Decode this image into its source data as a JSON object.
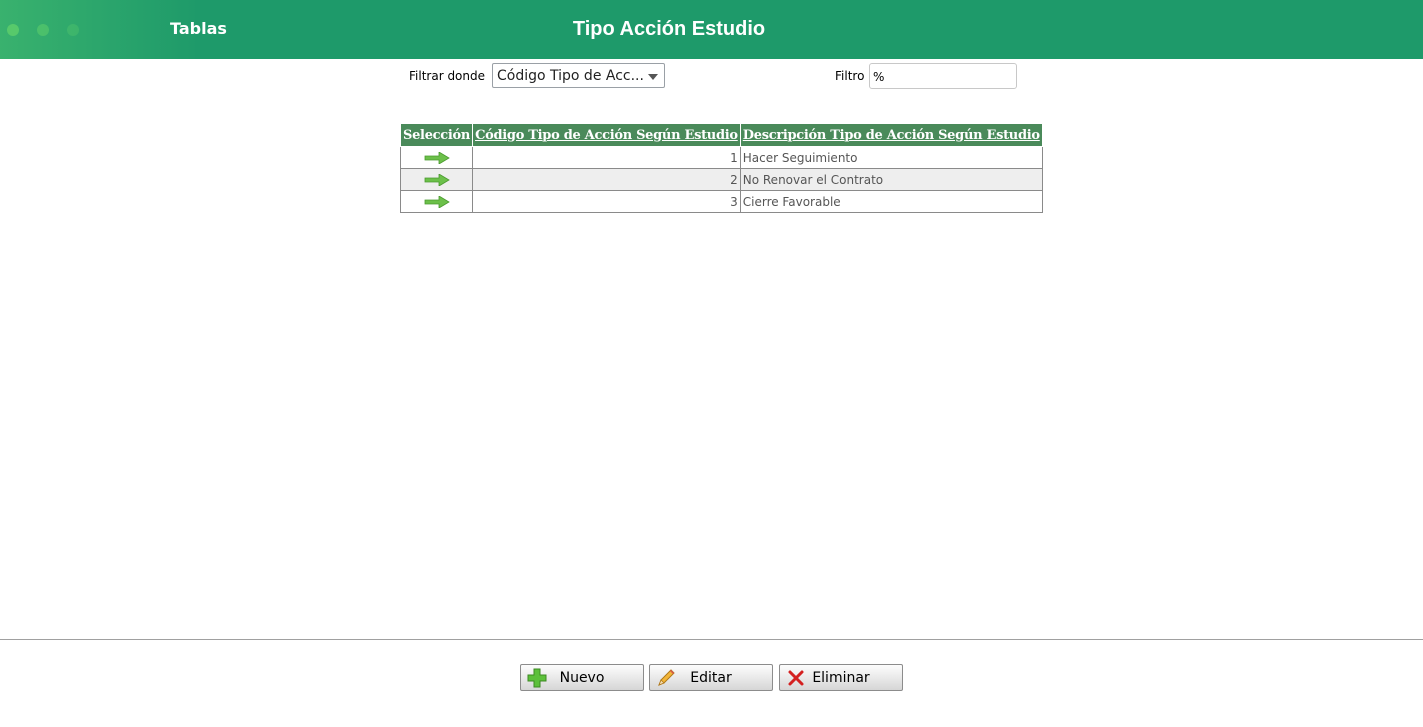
{
  "header": {
    "section": "Tablas",
    "title": "Tipo Acción Estudio"
  },
  "filter": {
    "label": "Filtrar donde",
    "selected": "Código Tipo de Acc...",
    "filtro_label": "Filtro",
    "filtro_value": "%"
  },
  "table": {
    "headers": [
      "Selección",
      "Código Tipo de Acción Según Estudio",
      "Descripción Tipo de Acción Según Estudio"
    ],
    "rows": [
      {
        "code": "1",
        "desc": "Hacer Seguimiento"
      },
      {
        "code": "2",
        "desc": "No Renovar el Contrato"
      },
      {
        "code": "3",
        "desc": "Cierre Favorable"
      }
    ]
  },
  "buttons": {
    "nuevo": "Nuevo",
    "editar": "Editar",
    "eliminar": "Eliminar"
  },
  "colors": {
    "header_bg": "#1e9a6a",
    "table_header_bg": "#4a8a5a",
    "arrow_green": "#6cc04a"
  },
  "icons": {
    "select_row": "arrow-right-icon",
    "nuevo": "plus-icon",
    "editar": "pencil-icon",
    "eliminar": "x-icon"
  }
}
